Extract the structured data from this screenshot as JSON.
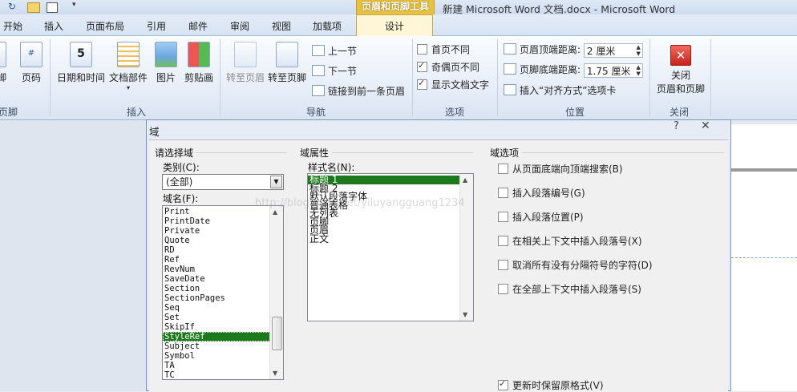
{
  "titlebar": {
    "context_tab_group": "页眉和页脚工具",
    "doc_title": "新建 Microsoft Word 文档.docx  -  Microsoft Word",
    "qat_icons": [
      "undo-icon",
      "redo-icon",
      "quick-part-icon",
      "table-icon",
      "customize-qat-icon"
    ]
  },
  "tabs": [
    "开始",
    "插入",
    "页面布局",
    "引用",
    "邮件",
    "审阅",
    "视图",
    "加载项",
    "设计"
  ],
  "ribbon": {
    "groups": {
      "header_footer": {
        "label": "页脚",
        "items": [
          "脚",
          "页码"
        ]
      },
      "insert": {
        "label": "插入",
        "items": [
          "日期和时间",
          "文档部件",
          "图片",
          "剪贴画"
        ]
      },
      "navigation": {
        "label": "导航",
        "items": [
          "转至页眉",
          "转至页脚",
          "上一节",
          "下一节",
          "链接到前一条页眉"
        ]
      },
      "options": {
        "label": "选项",
        "items": [
          {
            "label": "首页不同",
            "checked": false
          },
          {
            "label": "奇偶页不同",
            "checked": true
          },
          {
            "label": "显示文档文字",
            "checked": true
          }
        ]
      },
      "position": {
        "label": "位置",
        "header_distance_label": "页眉顶端距离:",
        "header_distance_value": "2 厘米",
        "footer_distance_label": "页脚底端距离:",
        "footer_distance_value": "1.75 厘米",
        "insert_align_tab": "插入“对齐方式”选项卡"
      },
      "close": {
        "label": "关闭",
        "button_line1": "关闭",
        "button_line2": "页眉和页脚"
      }
    }
  },
  "dialog": {
    "title": "域",
    "help": "?",
    "close": "✕",
    "choose_field": "请选择域",
    "category_label": "类别(C):",
    "category_value": "(全部)",
    "field_names_label": "域名(F):",
    "field_names": [
      "Print",
      "PrintDate",
      "Private",
      "Quote",
      "RD",
      "Ref",
      "RevNum",
      "SaveDate",
      "Section",
      "SectionPages",
      "Seq",
      "Set",
      "SkipIf",
      "StyleRef",
      "Subject",
      "Symbol",
      "TA",
      "TC"
    ],
    "field_names_selected": "StyleRef",
    "field_props": "域属性",
    "style_name_label": "样式名(N):",
    "style_names": [
      "标题 1",
      "标题 2",
      "默认段落字体",
      "普通表格",
      "无列表",
      "页脚",
      "页眉",
      "正文"
    ],
    "style_selected": "标题 1",
    "field_options": "域选项",
    "options": [
      {
        "label": "从页面底端向顶端搜索(B)",
        "checked": false
      },
      {
        "label": "插入段落编号(G)",
        "checked": false
      },
      {
        "label": "插入段落位置(P)",
        "checked": false
      },
      {
        "label": "在相关上下文中插入段落号(X)",
        "checked": false
      },
      {
        "label": "取消所有没有分隔符号的字符(D)",
        "checked": false
      },
      {
        "label": "在全部上下文中插入段落号(S)",
        "checked": false
      }
    ],
    "preserve_format": {
      "label": "更新时保留原格式(V)",
      "checked": true
    }
  },
  "watermark": "http://blog.csdn.net/yiluyangguang1234",
  "colors": {
    "selection": "#1c7a1c",
    "context_tab": "#e8c23e",
    "close_red": "#d9302c"
  }
}
